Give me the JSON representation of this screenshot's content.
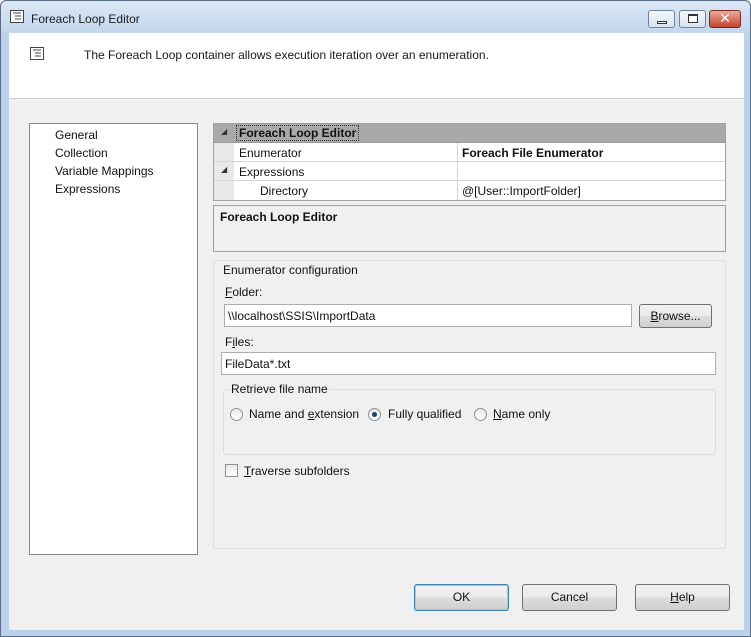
{
  "window": {
    "title": "Foreach Loop Editor",
    "title_icon": "foreach-loop-icon"
  },
  "header": {
    "description": "The Foreach Loop container allows execution iteration over an enumeration.",
    "icon": "foreach-loop-icon"
  },
  "nav": {
    "items": [
      "General",
      "Collection",
      "Variable Mappings",
      "Expressions"
    ],
    "selected": "Collection"
  },
  "property_grid": {
    "category": "Foreach Loop Editor",
    "rows": [
      {
        "name": "Enumerator",
        "value": "Foreach File Enumerator"
      },
      {
        "name": "Expressions",
        "value": ""
      },
      {
        "name": "Directory",
        "value": "@[User::ImportFolder]"
      }
    ]
  },
  "description_box": {
    "title": "Foreach Loop Editor"
  },
  "enumerator_config": {
    "group_label": "Enumerator configuration",
    "folder": {
      "label_accel": "F",
      "label_rest": "older:",
      "value": "\\\\localhost\\SSIS\\ImportData"
    },
    "browse": {
      "label_accel": "B",
      "label_rest": "rowse..."
    },
    "files": {
      "label_pre": "F",
      "label_accel": "i",
      "label_rest": "les:",
      "value": "FileData*.txt"
    },
    "retrieve_group": {
      "label": "Retrieve file name",
      "options": {
        "name_ext": {
          "pre": "Name and ",
          "accel": "e",
          "post": "xtension"
        },
        "fully_qualified": {
          "pre": "Fully qualified",
          "accel": "",
          "post": ""
        },
        "name_only": {
          "pre": "",
          "accel": "N",
          "post": "ame only"
        }
      },
      "selected": "Fully qualified"
    },
    "traverse": {
      "accel": "T",
      "rest": "raverse subfolders",
      "checked": false
    }
  },
  "footer": {
    "ok": "OK",
    "cancel": "Cancel",
    "help": {
      "accel": "H",
      "rest": "elp"
    }
  }
}
